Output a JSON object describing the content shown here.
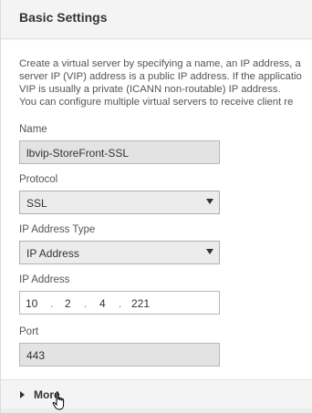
{
  "panel": {
    "title": "Basic Settings"
  },
  "description": {
    "lines": [
      "Create a virtual server by specifying a name, an IP address, a",
      "server IP (VIP) address is a public IP address. If the applicatio",
      "VIP is usually a private (ICANN non-routable) IP address.",
      "You can configure multiple virtual servers to receive client re"
    ]
  },
  "fields": {
    "name": {
      "label": "Name",
      "value": "lbvip-StoreFront-SSL"
    },
    "protocol": {
      "label": "Protocol",
      "value": "SSL"
    },
    "ip_address_type": {
      "label": "IP Address Type",
      "value": "IP Address"
    },
    "ip_address": {
      "label": "IP Address",
      "octets": [
        "10",
        "2",
        "4",
        "221"
      ]
    },
    "port": {
      "label": "Port",
      "value": "443"
    }
  },
  "more": {
    "label": "More"
  },
  "icons": {
    "dropdown": "chevron-down-icon",
    "expand": "triangle-right-icon",
    "cursor": "hand-pointer-cursor-icon"
  }
}
